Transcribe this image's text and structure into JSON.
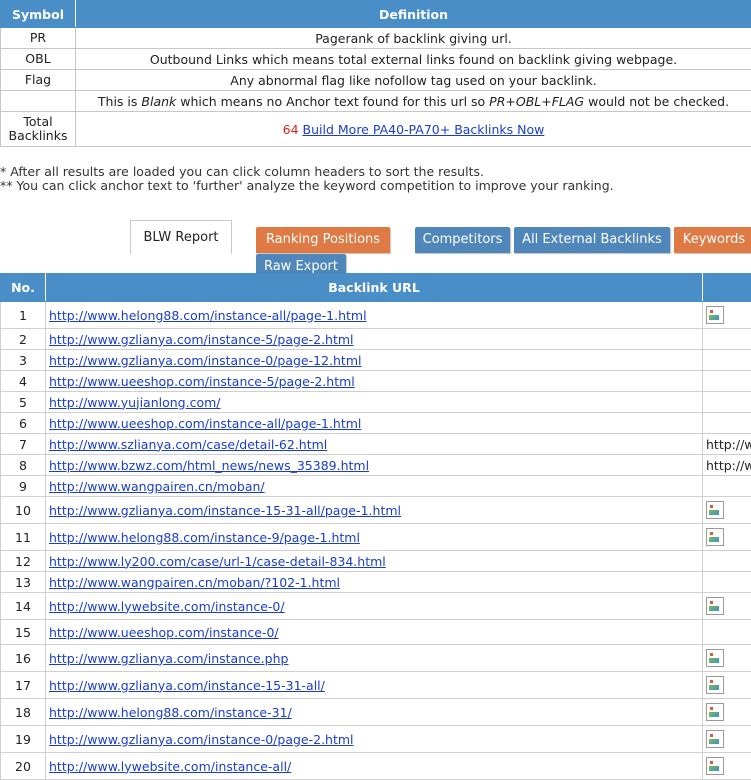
{
  "legend": {
    "headers": {
      "symbol": "Symbol",
      "definition": "Definition"
    },
    "rows": [
      {
        "symbol": "PR",
        "definition": "Pagerank of backlink giving url."
      },
      {
        "symbol": "OBL",
        "definition": "Outbound Links which means total external links found on backlink giving webpage."
      },
      {
        "symbol": "Flag",
        "definition": "Any abnormal flag like nofollow tag used on your backlink."
      }
    ],
    "blank_row": {
      "prefix": "This is ",
      "blank_word": "Blank",
      "middle": " which means no Anchor text found for this url so ",
      "fields": "PR+OBL+FLAG",
      "suffix": " would not be checked."
    },
    "total": {
      "label_line1": "Total",
      "label_line2": "Backlinks",
      "count": "64",
      "link_text": "Build More PA40-PA70+ Backlinks Now"
    }
  },
  "notes": [
    "* After all results are loaded you can click column headers to sort the results.",
    "** You can click anchor text to 'further' analyze the keyword competition to improve your ranking."
  ],
  "tabs": {
    "blw_report": "BLW Report",
    "ranking_positions": "Ranking Positions",
    "competitors": "Competitors",
    "all_external_backlinks": "All External Backlinks",
    "keywords": "Keywords",
    "raw_export": "Raw Export"
  },
  "colors": {
    "header_blue": "#4a8ec7",
    "tab_orange": "#e07a45",
    "tab_blue": "#4f87ba",
    "link_blue": "#1a3ec8",
    "count_red": "#d22222"
  },
  "results": {
    "headers": {
      "no": "No.",
      "url": "Backlink URL",
      "extra": ""
    },
    "rows": [
      {
        "no": "1",
        "url": "http://www.helong88.com/instance-all/page-1.html",
        "extra": "",
        "icon": true,
        "h": "t"
      },
      {
        "no": "2",
        "url": "http://www.gzlianya.com/instance-5/page-2.html",
        "extra": "",
        "icon": false,
        "h": "s"
      },
      {
        "no": "3",
        "url": "http://www.gzlianya.com/instance-0/page-12.html",
        "extra": "",
        "icon": false,
        "h": "s"
      },
      {
        "no": "4",
        "url": "http://www.ueeshop.com/instance-5/page-2.html",
        "extra": "",
        "icon": false,
        "h": "s"
      },
      {
        "no": "5",
        "url": "http://www.yujianlong.com/",
        "extra": "",
        "icon": false,
        "h": "s"
      },
      {
        "no": "6",
        "url": "http://www.ueeshop.com/instance-all/page-1.html",
        "extra": "",
        "icon": false,
        "h": "s"
      },
      {
        "no": "7",
        "url": "http://www.szlianya.com/case/detail-62.html",
        "extra": "http://w",
        "icon": false,
        "h": "s"
      },
      {
        "no": "8",
        "url": "http://www.bzwz.com/html_news/news_35389.html",
        "extra": "http://w",
        "icon": false,
        "h": "s"
      },
      {
        "no": "9",
        "url": "http://www.wangpairen.cn/moban/",
        "extra": "",
        "icon": false,
        "h": "s"
      },
      {
        "no": "10",
        "url": "http://www.gzlianya.com/instance-15-31-all/page-1.html",
        "extra": "",
        "icon": true,
        "h": "t"
      },
      {
        "no": "11",
        "url": "http://www.helong88.com/instance-9/page-1.html",
        "extra": "",
        "icon": true,
        "h": "t"
      },
      {
        "no": "12",
        "url": "http://www.ly200.com/case/url-1/case-detail-834.html",
        "extra": "",
        "icon": false,
        "h": "s"
      },
      {
        "no": "13",
        "url": "http://www.wangpairen.cn/moban/?102-1.html",
        "extra": "",
        "icon": false,
        "h": "s"
      },
      {
        "no": "14",
        "url": "http://www.lywebsite.com/instance-0/",
        "extra": "",
        "icon": true,
        "h": "t"
      },
      {
        "no": "15",
        "url": "http://www.ueeshop.com/instance-0/",
        "extra": "",
        "icon": false,
        "h": "m"
      },
      {
        "no": "16",
        "url": "http://www.gzlianya.com/instance.php",
        "extra": "",
        "icon": true,
        "h": "t"
      },
      {
        "no": "17",
        "url": "http://www.gzlianya.com/instance-15-31-all/",
        "extra": "",
        "icon": true,
        "h": "t"
      },
      {
        "no": "18",
        "url": "http://www.helong88.com/instance-31/",
        "extra": "",
        "icon": true,
        "h": "t"
      },
      {
        "no": "19",
        "url": "http://www.gzlianya.com/instance-0/page-2.html",
        "extra": "",
        "icon": true,
        "h": "t"
      },
      {
        "no": "20",
        "url": "http://www.lywebsite.com/instance-all/",
        "extra": "",
        "icon": true,
        "h": "t"
      }
    ]
  }
}
